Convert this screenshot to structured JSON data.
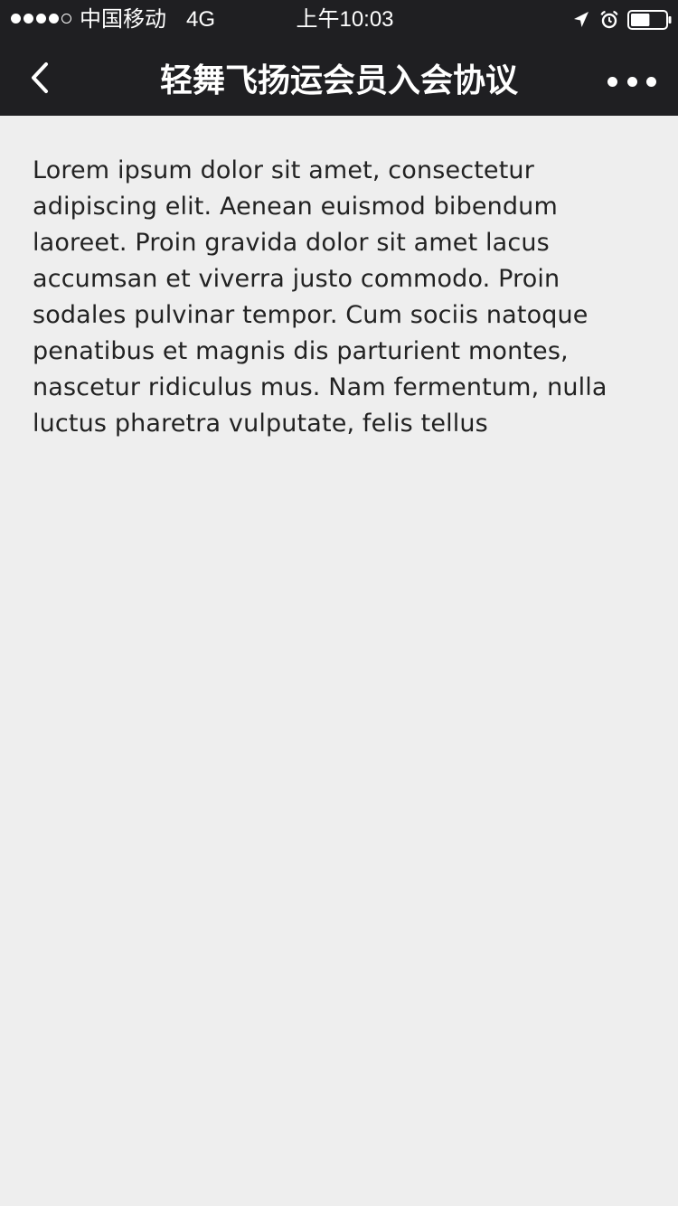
{
  "status_bar": {
    "carrier": "中国移动",
    "network": "4G",
    "time": "上午10:03",
    "signal_filled": 4,
    "signal_total": 5,
    "battery_level": 0.55,
    "icons": [
      "location-arrow-icon",
      "alarm-clock-icon",
      "battery-icon"
    ]
  },
  "nav": {
    "back_icon": "chevron-left-icon",
    "title": "轻舞飞扬运会员入会协议",
    "more_icon": "more-dots-icon"
  },
  "content": {
    "body": "Lorem ipsum dolor sit amet, consectetur adipiscing elit. Aenean euismod bibendum laoreet. Proin gravida dolor sit amet lacus accumsan et viverra justo commodo. Proin sodales pulvinar tempor. Cum sociis natoque penatibus et magnis dis parturient montes, nascetur ridiculus mus. Nam fermentum, nulla luctus pharetra vulputate, felis tellus"
  },
  "colors": {
    "header_bg": "#1f1f22",
    "page_bg": "#eeeeee",
    "text": "#222222",
    "header_text": "#ffffff"
  }
}
